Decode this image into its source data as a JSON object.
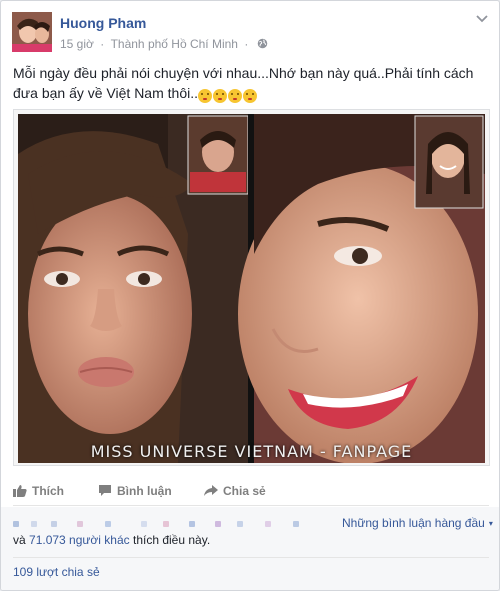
{
  "post": {
    "author": "Huong Pham",
    "time": "15 giờ",
    "location": "Thành phố Hồ Chí Minh",
    "separator": "·",
    "text_line1": "Mỗi ngày đều phải nói chuyện với nhau...Nhớ bạn này quá..Phải tính cách",
    "text_line2": "đưa bạn ấy về Việt Nam thôi..",
    "emoji_count": 4,
    "photo_caption": "MISS UNIVERSE VIETNAM - FANPAGE"
  },
  "actions": {
    "like": "Thích",
    "comment": "Bình luận",
    "share": "Chia sẻ"
  },
  "footer": {
    "sort_label": "Những bình luận hàng đầu",
    "sort_caret": "▾",
    "likes_prefix": "và ",
    "likes_link": "71.073 người khác",
    "likes_suffix": " thích điều này.",
    "shares": "109 lượt chia sẻ"
  },
  "icons": {
    "chevron": "chevron-down-icon",
    "globe": "globe-icon",
    "like": "thumbs-up-icon",
    "comment": "comment-icon",
    "share": "share-arrow-icon"
  },
  "colors": {
    "link": "#365899",
    "muted": "#90949c",
    "action": "#7f7f7f",
    "footer_bg": "#f6f7f9"
  }
}
